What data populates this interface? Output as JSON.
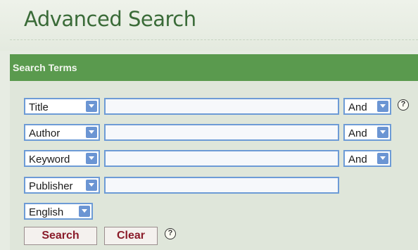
{
  "page": {
    "title": "Advanced Search"
  },
  "section": {
    "title": "Search Terms"
  },
  "rows": [
    {
      "field": "Title",
      "value": "",
      "operator": "And"
    },
    {
      "field": "Author",
      "value": "",
      "operator": "And"
    },
    {
      "field": "Keyword",
      "value": "",
      "operator": "And"
    },
    {
      "field": "Publisher",
      "value": ""
    }
  ],
  "language": {
    "selected": "English"
  },
  "buttons": {
    "search": "Search",
    "clear": "Clear"
  },
  "help": {
    "glyph": "?"
  },
  "icons": {
    "dropdown": "chevron-down-icon",
    "help": "help-icon"
  },
  "colors": {
    "title": "#3a6b38",
    "section_bar": "#5a9a4e",
    "input_border": "#6d9bd6",
    "button_text": "#8a1c2a"
  }
}
